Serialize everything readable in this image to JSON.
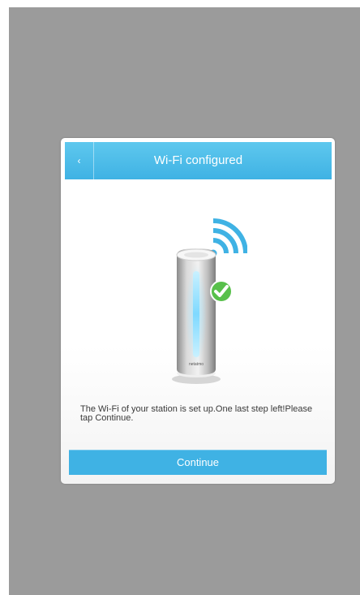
{
  "dialog": {
    "title": "Wi-Fi configured",
    "back_icon": "chevron-left-icon",
    "back_glyph": "‹",
    "message": "The Wi-Fi of your station is set up.One last step left!Please tap Continue.",
    "continue_label": "Continue",
    "station_brand": "netatmo"
  },
  "colors": {
    "background": "#9b9b9b",
    "accent": "#3fb2e4",
    "header": "#5ec8ee",
    "check": "#58c04b",
    "station_light": "#7fd9ff"
  }
}
